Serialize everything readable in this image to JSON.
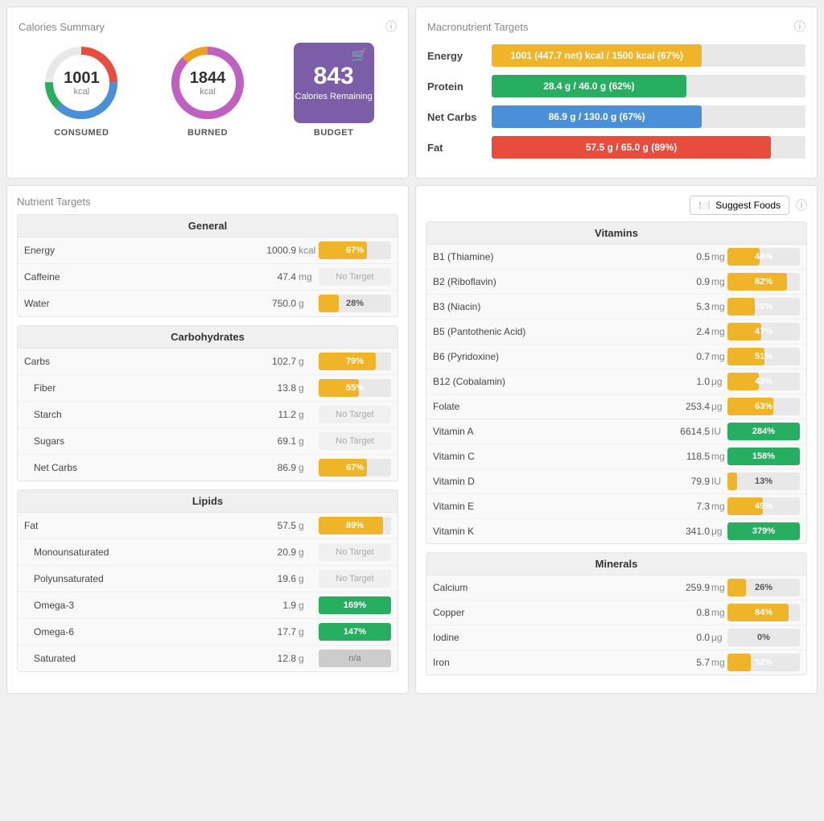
{
  "calories_summary": {
    "title": "Calories Summary",
    "consumed": {
      "value": "1001",
      "unit": "kcal",
      "label": "CONSUMED"
    },
    "burned": {
      "value": "1844",
      "unit": "kcal",
      "label": "BURNED"
    },
    "budget": {
      "value": "843",
      "sub": "Calories Remaining",
      "label": "BUDGET"
    }
  },
  "macro_targets": {
    "title": "Macronutrient Targets",
    "rows": [
      {
        "label": "Energy",
        "text": "1001 (447.7 net) kcal / 1500 kcal (67%)",
        "pct": 67,
        "color": "#f0b429",
        "over": false
      },
      {
        "label": "Protein",
        "text": "28.4 g / 46.0 g (62%)",
        "pct": 62,
        "color": "#27ae60",
        "over": false
      },
      {
        "label": "Net Carbs",
        "text": "86.9 g / 130.0 g (67%)",
        "pct": 67,
        "color": "#4a90d9",
        "over": false
      },
      {
        "label": "Fat",
        "text": "57.5 g / 65.0 g (89%)",
        "pct": 89,
        "color": "#e74c3c",
        "over": false
      }
    ]
  },
  "nutrient_targets": {
    "title": "Nutrient Targets",
    "suggest_label": "Suggest Foods",
    "groups": [
      {
        "title": "General",
        "rows": [
          {
            "name": "Energy",
            "value": "1000.9",
            "unit": "kcal",
            "pct": 67,
            "type": "bar",
            "color": "#f0b429"
          },
          {
            "name": "Caffeine",
            "value": "47.4",
            "unit": "mg",
            "pct": 0,
            "type": "no_target"
          },
          {
            "name": "Water",
            "value": "750.0",
            "unit": "g",
            "pct": 28,
            "type": "bar",
            "color": "#f0b429"
          }
        ]
      },
      {
        "title": "Carbohydrates",
        "rows": [
          {
            "name": "Carbs",
            "value": "102.7",
            "unit": "g",
            "pct": 79,
            "type": "bar",
            "color": "#f0b429",
            "sub": false
          },
          {
            "name": "Fiber",
            "value": "13.8",
            "unit": "g",
            "pct": 55,
            "type": "bar",
            "color": "#f0b429",
            "sub": true
          },
          {
            "name": "Starch",
            "value": "11.2",
            "unit": "g",
            "pct": 0,
            "type": "no_target",
            "sub": true
          },
          {
            "name": "Sugars",
            "value": "69.1",
            "unit": "g",
            "pct": 0,
            "type": "no_target",
            "sub": true
          },
          {
            "name": "Net Carbs",
            "value": "86.9",
            "unit": "g",
            "pct": 67,
            "type": "bar",
            "color": "#f0b429",
            "sub": true
          }
        ]
      },
      {
        "title": "Lipids",
        "rows": [
          {
            "name": "Fat",
            "value": "57.5",
            "unit": "g",
            "pct": 89,
            "type": "bar",
            "color": "#f0b429",
            "sub": false
          },
          {
            "name": "Monounsaturated",
            "value": "20.9",
            "unit": "g",
            "pct": 0,
            "type": "no_target",
            "sub": true
          },
          {
            "name": "Polyunsaturated",
            "value": "19.6",
            "unit": "g",
            "pct": 0,
            "type": "no_target",
            "sub": true
          },
          {
            "name": "Omega-3",
            "value": "1.9",
            "unit": "g",
            "pct": 169,
            "type": "bar_over",
            "color": "#27ae60",
            "sub": true
          },
          {
            "name": "Omega-6",
            "value": "17.7",
            "unit": "g",
            "pct": 147,
            "type": "bar_over",
            "color": "#27ae60",
            "sub": true
          },
          {
            "name": "Saturated",
            "value": "12.8",
            "unit": "g",
            "pct": 0,
            "type": "na",
            "sub": true
          }
        ]
      }
    ]
  },
  "vitamins": {
    "title": "Vitamins",
    "rows": [
      {
        "name": "B1 (Thiamine)",
        "value": "0.5",
        "unit": "mg",
        "pct": 44,
        "color": "#f0b429"
      },
      {
        "name": "B2 (Riboflavin)",
        "value": "0.9",
        "unit": "mg",
        "pct": 82,
        "color": "#f0b429"
      },
      {
        "name": "B3 (Niacin)",
        "value": "5.3",
        "unit": "mg",
        "pct": 38,
        "color": "#f0b429"
      },
      {
        "name": "B5 (Pantothenic Acid)",
        "value": "2.4",
        "unit": "mg",
        "pct": 47,
        "color": "#f0b429"
      },
      {
        "name": "B6 (Pyridoxine)",
        "value": "0.7",
        "unit": "mg",
        "pct": 51,
        "color": "#f0b429"
      },
      {
        "name": "B12 (Cobalamin)",
        "value": "1.0",
        "unit": "μg",
        "pct": 43,
        "color": "#f0b429"
      },
      {
        "name": "Folate",
        "value": "253.4",
        "unit": "μg",
        "pct": 63,
        "color": "#f0b429"
      },
      {
        "name": "Vitamin A",
        "value": "6614.5",
        "unit": "IU",
        "pct": 100,
        "display_pct": "284%",
        "color": "#27ae60",
        "over": true
      },
      {
        "name": "Vitamin C",
        "value": "118.5",
        "unit": "mg",
        "pct": 100,
        "display_pct": "158%",
        "color": "#27ae60",
        "over": true
      },
      {
        "name": "Vitamin D",
        "value": "79.9",
        "unit": "IU",
        "pct": 13,
        "color": "#f0b429"
      },
      {
        "name": "Vitamin E",
        "value": "7.3",
        "unit": "mg",
        "pct": 49,
        "color": "#f0b429"
      },
      {
        "name": "Vitamin K",
        "value": "341.0",
        "unit": "μg",
        "pct": 100,
        "display_pct": "379%",
        "color": "#27ae60",
        "over": true
      }
    ]
  },
  "minerals": {
    "title": "Minerals",
    "rows": [
      {
        "name": "Calcium",
        "value": "259.9",
        "unit": "mg",
        "pct": 26,
        "color": "#f0b429"
      },
      {
        "name": "Copper",
        "value": "0.8",
        "unit": "mg",
        "pct": 84,
        "color": "#f0b429"
      },
      {
        "name": "Iodine",
        "value": "0.0",
        "unit": "μg",
        "pct": 0,
        "color": "#e8e8e8"
      },
      {
        "name": "Iron",
        "value": "5.7",
        "unit": "mg",
        "pct": 32,
        "color": "#f0b429"
      }
    ]
  }
}
